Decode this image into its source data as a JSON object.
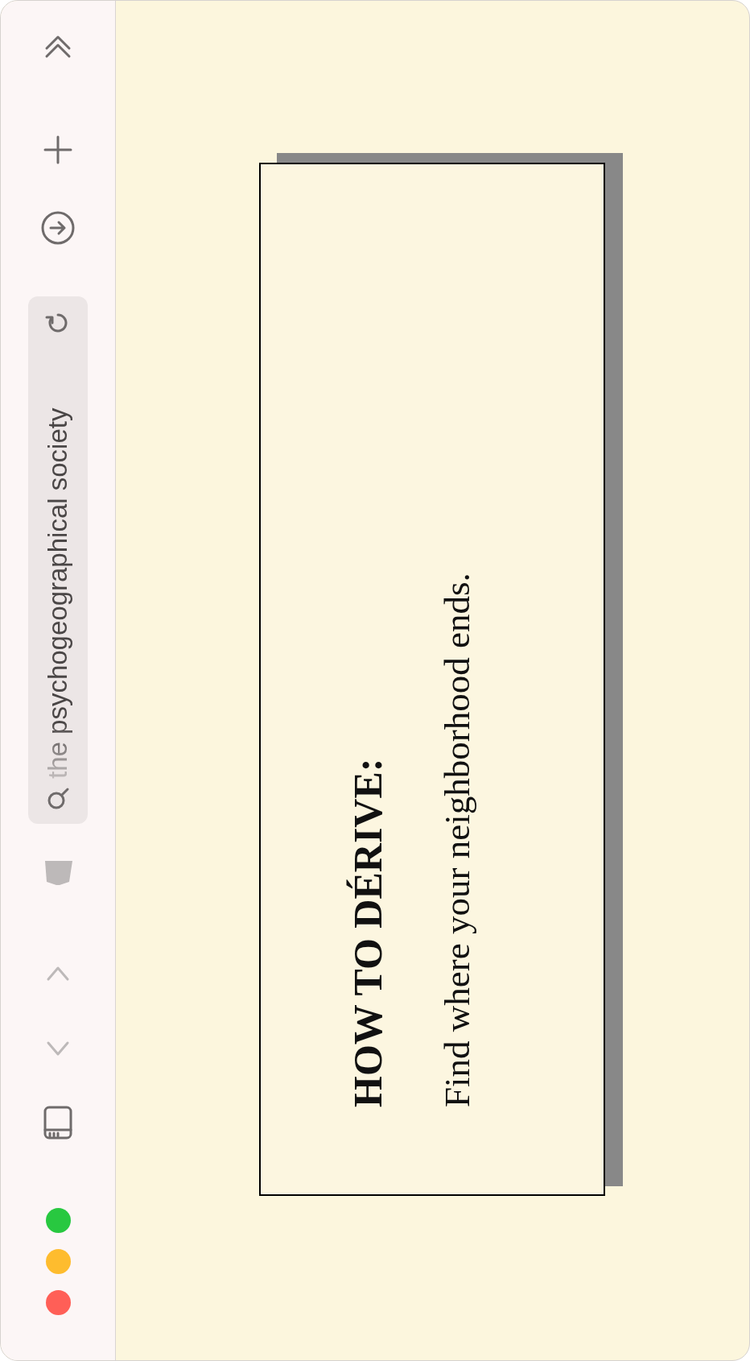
{
  "window": {
    "controls": [
      {
        "color": "#ff5f57"
      },
      {
        "color": "#febc2e"
      },
      {
        "color": "#28c840"
      }
    ]
  },
  "toolbar": {
    "page_nav": [
      {
        "kind": "down",
        "disabled": true
      },
      {
        "kind": "up",
        "disabled": true
      }
    ],
    "address_bar": {
      "text": "the psychogeographical society"
    }
  },
  "card": {
    "title": "HOW TO DÉRIVE:",
    "text": "Find where your neighborhood ends."
  }
}
